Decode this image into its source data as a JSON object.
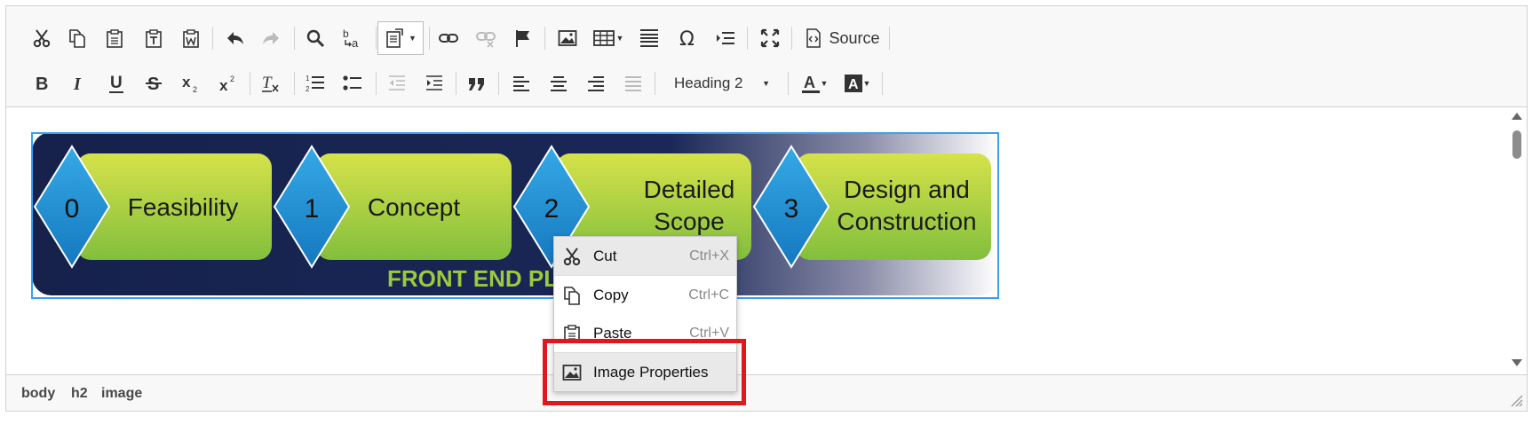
{
  "toolbar": {
    "source_label": "Source",
    "format_value": "Heading 2"
  },
  "diagram": {
    "stages": [
      {
        "number": "0",
        "label": "Feasibility"
      },
      {
        "number": "1",
        "label": "Concept"
      },
      {
        "number": "2",
        "label_line1": "Detailed",
        "label_line2": "Scope"
      },
      {
        "number": "3",
        "label_line1": "Design and",
        "label_line2": "Construction"
      }
    ],
    "footer_text": "FRONT END PL"
  },
  "context_menu": {
    "items": [
      {
        "label": "Cut",
        "shortcut": "Ctrl+X",
        "icon": "scissors-icon"
      },
      {
        "label": "Copy",
        "shortcut": "Ctrl+C",
        "icon": "copy-icon"
      },
      {
        "label": "Paste",
        "shortcut": "Ctrl+V",
        "icon": "paste-icon"
      },
      {
        "label": "Image Properties",
        "icon": "image-icon"
      }
    ]
  },
  "status_path": [
    "body",
    "h2",
    "image"
  ],
  "colors": {
    "selection_border": "#3b9ff3",
    "highlight_box": "#e0171b",
    "diagram_bg": "#16224c",
    "stage_green": "#9acb3c",
    "diamond_blue": "#1e8fd6"
  }
}
